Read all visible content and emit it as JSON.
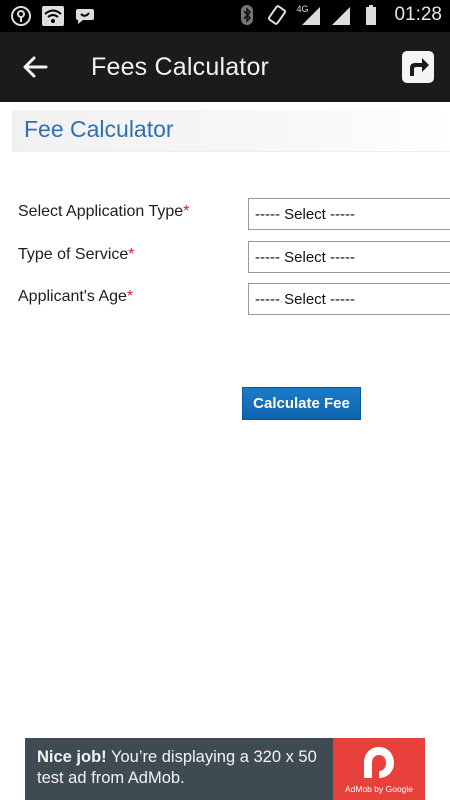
{
  "status_bar": {
    "time": "01:28",
    "network_label": "4G",
    "icons": [
      "vpn-icon",
      "wifi-icon",
      "chat-icon",
      "bluetooth-icon",
      "rotation-icon",
      "signal-icon",
      "battery-icon"
    ]
  },
  "app_bar": {
    "title": "Fees Calculator",
    "back_icon": "arrow-left-icon",
    "share_icon": "share-icon"
  },
  "section": {
    "title": "Fee Calculator"
  },
  "form": {
    "fields": [
      {
        "label": "Select Application Type",
        "required_mark": "*",
        "value": "----- Select -----"
      },
      {
        "label": "Type of Service",
        "required_mark": "*",
        "value": "----- Select -----"
      },
      {
        "label": "Applicant's Age",
        "required_mark": "*",
        "value": "----- Select -----"
      }
    ],
    "calculate_label": "Calculate Fee"
  },
  "ad": {
    "headline": "Nice job!",
    "body": " You’re displaying a 320 x 50 test ad from AdMob.",
    "caption": "AdMob by Google"
  },
  "colors": {
    "app_bar": "#1b1b1b",
    "section_title": "#2f6fb3",
    "button": "#1470bd",
    "required": "#dd2222",
    "ad_background": "#3f4b52",
    "ad_logo": "#e8413b"
  }
}
